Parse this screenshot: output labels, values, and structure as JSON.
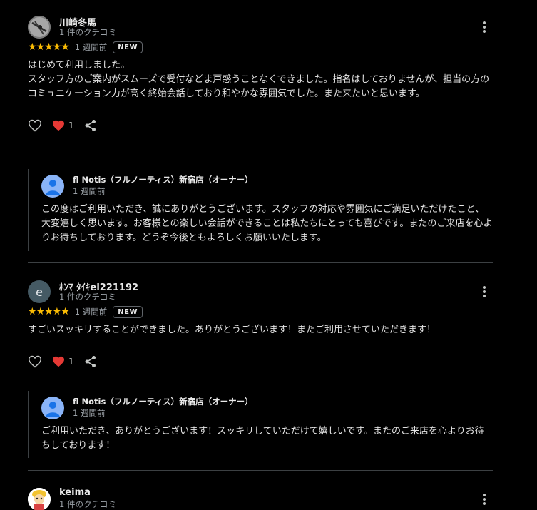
{
  "reviews": [
    {
      "name": "川崎冬馬",
      "review_count": "1 件のクチコミ",
      "rating": 5,
      "stars": "★★★★★",
      "time": "1 週間前",
      "badge": "NEW",
      "text_lines": [
        "はじめて利用しました。",
        "スタッフ方のご案内がスムーズで受付などま戸惑うことなくできました。指名はしておりませんが、担当の方のコミュニケーション力が高く終始会話しており和やかな雰囲気でした。また来たいと思います。"
      ],
      "reaction_count": "1",
      "avatar_icon": "photo-avatar",
      "reply": {
        "owner": "fl Notis（フルノーティス）新宿店（オーナー）",
        "time": "1 週間前",
        "text": "この度はご利用いただき、誠にありがとうございます。スタッフの対応や雰囲気にご満足いただけたこと、大変嬉しく思います。お客様との楽しい会話ができることは私たちにとっても喜びです。またのご来店を心よりお待ちしております。どうぞ今後ともよろしくお願いいたします。"
      }
    },
    {
      "name": "ﾎﾝﾏ ﾀｲｷel221192",
      "review_count": "1 件のクチコミ",
      "rating": 5,
      "stars": "★★★★★",
      "time": "1 週間前",
      "badge": "NEW",
      "avatar_letter": "e",
      "text_lines": [
        "すごいスッキリすることができました。ありがとうございます！またご利用させていただきます！"
      ],
      "reaction_count": "1",
      "reply": {
        "owner": "fl Notis（フルノーティス）新宿店（オーナー）",
        "time": "1 週間前",
        "text": "ご利用いただき、ありがとうございます！スッキリしていただけて嬉しいです。またのご来店を心よりお待ちしております！"
      }
    },
    {
      "name": "keima",
      "review_count": "1 件のクチコミ",
      "avatar_icon": "character-avatar"
    }
  ],
  "colors": {
    "star": "#fbbc04",
    "heart": "#e53935",
    "avatar_e": "#455a64",
    "owner_avatar": "#8ab4f8"
  }
}
